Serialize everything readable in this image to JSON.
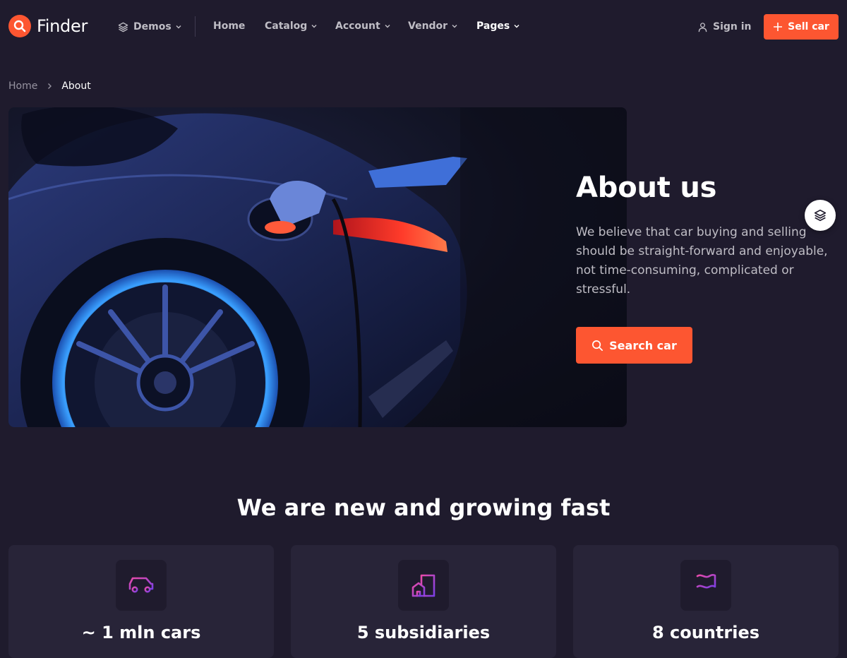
{
  "header": {
    "logo_text": "Finder",
    "demos_label": "Demos",
    "nav": [
      {
        "label": "Home"
      },
      {
        "label": "Catalog"
      },
      {
        "label": "Account"
      },
      {
        "label": "Vendor"
      },
      {
        "label": "Pages"
      }
    ],
    "signin_label": "Sign in",
    "sell_label": "Sell car"
  },
  "breadcrumb": {
    "home": "Home",
    "current": "About"
  },
  "hero": {
    "title": "About us",
    "description": "We believe that car buying and selling should be straight-forward and enjoyable, not time-consuming, complicated or stressful.",
    "button_label": "Search car"
  },
  "stats": {
    "title": "We are new and growing fast",
    "items": [
      {
        "icon": "car-icon",
        "value": "~ 1 mln cars"
      },
      {
        "icon": "building-icon",
        "value": "5 subsidiaries"
      },
      {
        "icon": "flag-icon",
        "value": "8 countries"
      }
    ]
  },
  "colors": {
    "background": "#1f1b2d",
    "card": "#282438",
    "accent": "#fd5631",
    "text_muted": "#bfbdc5"
  }
}
